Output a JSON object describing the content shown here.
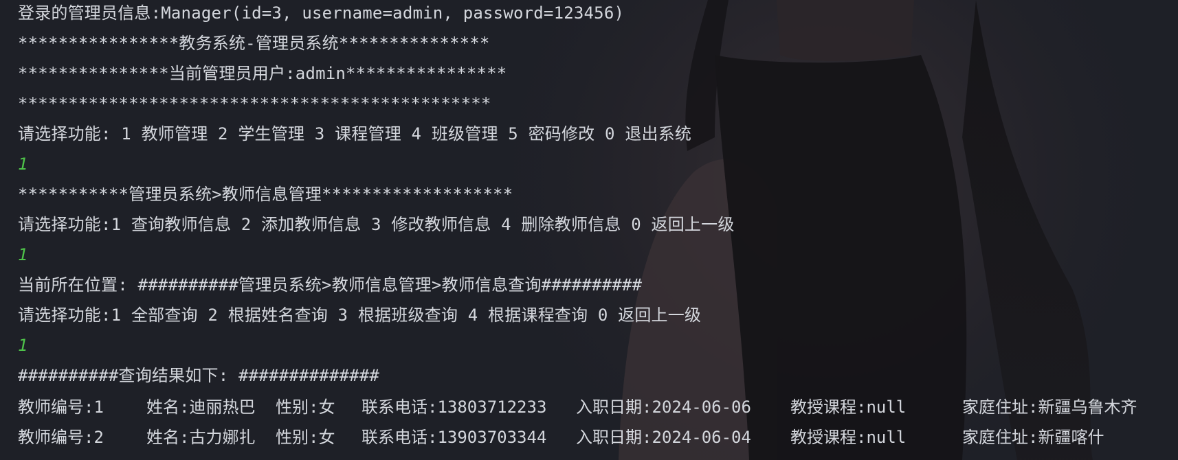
{
  "console": {
    "lines": [
      {
        "text": "登录的管理员信息:Manager(id=3, username=admin, password=123456)",
        "kind": "output"
      },
      {
        "text": "****************教务系统-管理员系统***************",
        "kind": "output"
      },
      {
        "text": "***************当前管理员用户:admin****************",
        "kind": "output"
      },
      {
        "text": "***********************************************",
        "kind": "output"
      },
      {
        "text": "请选择功能: 1 教师管理 2 学生管理 3 课程管理 4 班级管理 5 密码修改 0 退出系统",
        "kind": "output"
      },
      {
        "text": "1",
        "kind": "input"
      },
      {
        "text": "***********管理员系统>教师信息管理*******************",
        "kind": "output"
      },
      {
        "text": "请选择功能:1 查询教师信息 2 添加教师信息 3 修改教师信息 4 删除教师信息 0 返回上一级",
        "kind": "output"
      },
      {
        "text": "1",
        "kind": "input"
      },
      {
        "text": "当前所在位置: ##########管理员系统>教师信息管理>教师信息查询##########",
        "kind": "output"
      },
      {
        "text": "请选择功能:1 全部查询 2 根据姓名查询 3 根据班级查询 4 根据课程查询 0 返回上一级",
        "kind": "output"
      },
      {
        "text": "1",
        "kind": "input"
      },
      {
        "text": "##########查询结果如下: ##############",
        "kind": "output"
      }
    ],
    "teacher_rows": [
      {
        "id": "教师编号:1",
        "name": "姓名:迪丽热巴",
        "gender": "性别:女",
        "phone": "联系电话:13803712233",
        "hire_date": "入职日期:2024-06-06",
        "course": "教授课程:null",
        "address": "家庭住址:新疆乌鲁木齐"
      },
      {
        "id": "教师编号:2",
        "name": "姓名:古力娜扎",
        "gender": "性别:女",
        "phone": "联系电话:13903703344",
        "hire_date": "入职日期:2024-06-04",
        "course": "教授课程:null",
        "address": "家庭住址:新疆喀什"
      }
    ]
  },
  "colors": {
    "background": "#1e2027",
    "output_text": "#d4d7dd",
    "input_text": "#4fc34a"
  }
}
